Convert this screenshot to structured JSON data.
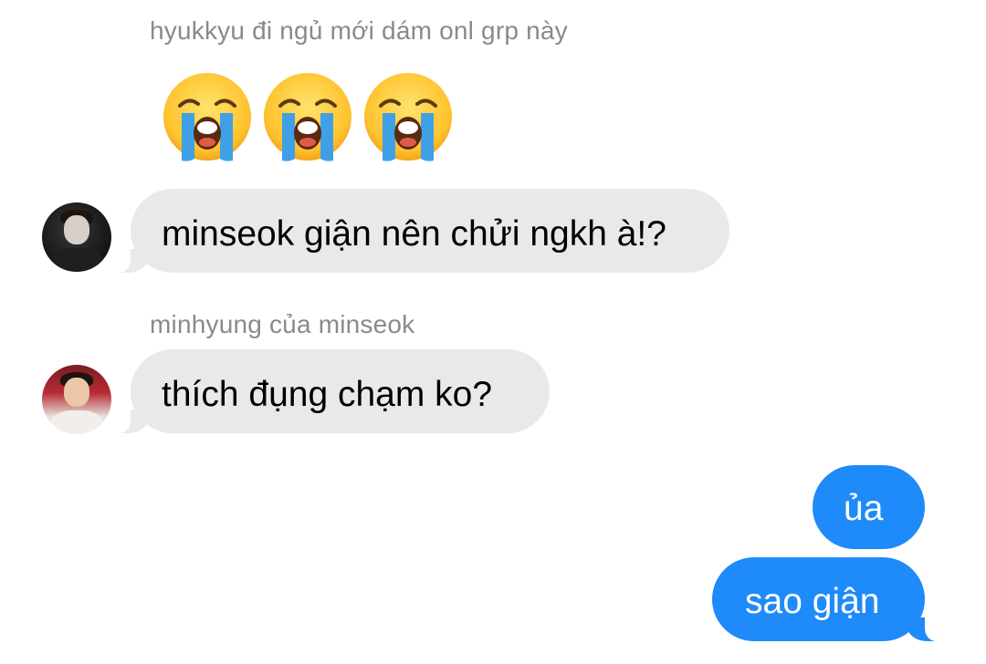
{
  "conversation": {
    "sender_names": [
      "hyukkyu đi ngủ mới dám onl grp này",
      "minhyung của minseok"
    ],
    "reaction": {
      "icon": "loudly-crying-face-icon",
      "count": 3
    },
    "messages": [
      {
        "from": "incoming",
        "text": "minseok giận nên chửi ngkh à!?"
      },
      {
        "from": "incoming",
        "text": "thích đụng chạm ko?"
      },
      {
        "from": "outgoing",
        "text": "ủa"
      },
      {
        "from": "outgoing",
        "text": "sao giận"
      }
    ]
  },
  "colors": {
    "incoming_bubble": "#e9e9eb",
    "outgoing_bubble": "#1f8af9",
    "sender_name": "#8a8a8e",
    "emoji_face": "#ffcd38",
    "emoji_tears": "#3fa0e6"
  }
}
